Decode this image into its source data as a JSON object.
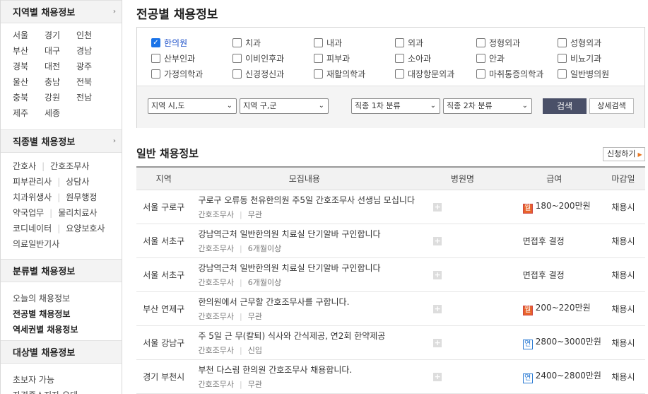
{
  "sidebar": {
    "region_title": "지역별 채용정보",
    "regions": [
      "서울",
      "경기",
      "인천",
      "부산",
      "대구",
      "경남",
      "경북",
      "대전",
      "광주",
      "울산",
      "충남",
      "전북",
      "충북",
      "강원",
      "전남",
      "제주",
      "세종"
    ],
    "job_title": "직종별 채용정보",
    "jobs": [
      [
        "간호사",
        "간호조무사"
      ],
      [
        "피부관리사",
        "상담사"
      ],
      [
        "치과위생사",
        "원무행정"
      ],
      [
        "약국업무",
        "물리치료사"
      ],
      [
        "코디네이터",
        "요양보호사"
      ],
      [
        "의료일반기사"
      ]
    ],
    "category_title": "분류별 채용정보",
    "categories": [
      "오늘의 채용정보",
      "전공별 채용정보",
      "역세권별 채용정보"
    ],
    "target_title": "대상별 채용정보",
    "targets": [
      "초보자 가능",
      "자격증소지자 우대"
    ]
  },
  "main": {
    "title": "전공별 채용정보",
    "majors": [
      {
        "label": "한의원",
        "checked": true
      },
      {
        "label": "치과",
        "checked": false
      },
      {
        "label": "내과",
        "checked": false
      },
      {
        "label": "외과",
        "checked": false
      },
      {
        "label": "정형외과",
        "checked": false
      },
      {
        "label": "성형외과",
        "checked": false
      },
      {
        "label": "산부인과",
        "checked": false
      },
      {
        "label": "이비인후과",
        "checked": false
      },
      {
        "label": "피부과",
        "checked": false
      },
      {
        "label": "소아과",
        "checked": false
      },
      {
        "label": "안과",
        "checked": false
      },
      {
        "label": "비뇨기과",
        "checked": false
      },
      {
        "label": "가정의학과",
        "checked": false
      },
      {
        "label": "신경정신과",
        "checked": false
      },
      {
        "label": "재활의학과",
        "checked": false
      },
      {
        "label": "대장항문외과",
        "checked": false
      },
      {
        "label": "마취통증의학과",
        "checked": false
      },
      {
        "label": "일반병의원",
        "checked": false
      }
    ],
    "filters": {
      "sido": "지역 시,도",
      "gugun": "지역 구,군",
      "job1": "직종 1차 분류",
      "job2": "직종 2차 분류",
      "search_label": "검색",
      "detail_label": "상세검색"
    },
    "section_title": "일반 채용정보",
    "apply_label": "신청하기",
    "table": {
      "headers": [
        "지역",
        "모집내용",
        "병원명",
        "급여",
        "마감일"
      ],
      "rows": [
        {
          "region": "서울 구로구",
          "title": "구로구 오류동 천유한의원 주5일 간호조무사 선생님 모십니다",
          "meta1": "간호조무사",
          "meta2": "무관",
          "pay_badge": "월",
          "pay": "180~200만원",
          "deadline": "채용시"
        },
        {
          "region": "서울 서초구",
          "title": "강남역근처 일반한의원 치료실 단기알바 구인합니다",
          "meta1": "간호조무사",
          "meta2": "6개월이상",
          "pay_badge": "",
          "pay": "면접후 결정",
          "deadline": "채용시"
        },
        {
          "region": "서울 서초구",
          "title": "강남역근처 일반한의원 치료실 단기알바 구인합니다",
          "meta1": "간호조무사",
          "meta2": "6개월이상",
          "pay_badge": "",
          "pay": "면접후 결정",
          "deadline": "채용시"
        },
        {
          "region": "부산 연제구",
          "title": "한의원에서 근무할 간호조무사를 구합니다.",
          "meta1": "간호조무사",
          "meta2": "무관",
          "pay_badge": "월",
          "pay": "200~220만원",
          "deadline": "채용시"
        },
        {
          "region": "서울 강남구",
          "title": "주 5일 근 무(칼퇴) 식사와 간식제공, 연2회 한약제공",
          "meta1": "간호조무사",
          "meta2": "신입",
          "pay_badge": "연",
          "pay": "2800~3000만원",
          "deadline": "채용시"
        },
        {
          "region": "경기 부천시",
          "title": "부천 다스림 한의원 간호조무사 채용합니다.",
          "meta1": "간호조무사",
          "meta2": "무관",
          "pay_badge": "연",
          "pay": "2400~2800만원",
          "deadline": "채용시"
        }
      ]
    }
  }
}
